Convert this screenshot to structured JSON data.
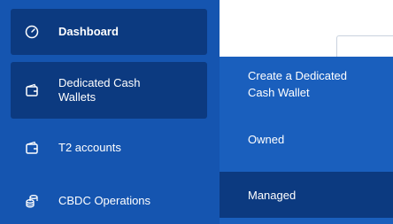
{
  "sidebar": {
    "items": [
      {
        "label": "Dashboard",
        "icon": "gauge-icon"
      },
      {
        "label": "Dedicated Cash Wallets",
        "icon": "wallet-icon"
      },
      {
        "label": "T2 accounts",
        "icon": "wallet-icon"
      },
      {
        "label": "CBDC Operations",
        "icon": "coins-stack-icon"
      }
    ]
  },
  "submenu": {
    "items": [
      {
        "label": "Create a Dedicated Cash Wallet"
      },
      {
        "label": "Owned"
      },
      {
        "label": "Managed"
      }
    ]
  },
  "colors": {
    "sidebar_bg": "#1555b0",
    "active_bg": "#0c3a80",
    "submenu_bg": "#1a5fbd",
    "text": "#ffffff"
  }
}
